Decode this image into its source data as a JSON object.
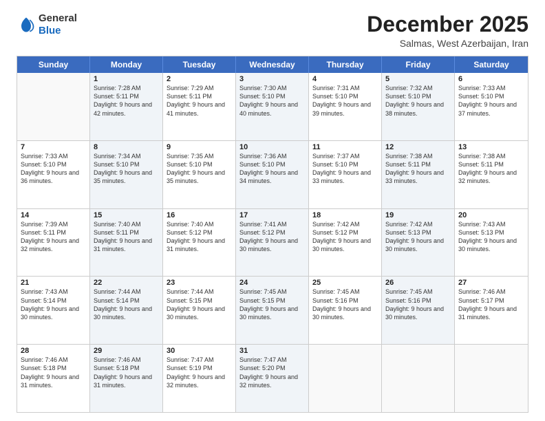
{
  "logo": {
    "general": "General",
    "blue": "Blue"
  },
  "header": {
    "month": "December 2025",
    "location": "Salmas, West Azerbaijan, Iran"
  },
  "weekdays": [
    "Sunday",
    "Monday",
    "Tuesday",
    "Wednesday",
    "Thursday",
    "Friday",
    "Saturday"
  ],
  "weeks": [
    [
      {
        "day": "",
        "sunrise": "",
        "sunset": "",
        "daylight": "",
        "shaded": false,
        "empty": true
      },
      {
        "day": "1",
        "sunrise": "Sunrise: 7:28 AM",
        "sunset": "Sunset: 5:11 PM",
        "daylight": "Daylight: 9 hours and 42 minutes.",
        "shaded": true
      },
      {
        "day": "2",
        "sunrise": "Sunrise: 7:29 AM",
        "sunset": "Sunset: 5:11 PM",
        "daylight": "Daylight: 9 hours and 41 minutes.",
        "shaded": false
      },
      {
        "day": "3",
        "sunrise": "Sunrise: 7:30 AM",
        "sunset": "Sunset: 5:10 PM",
        "daylight": "Daylight: 9 hours and 40 minutes.",
        "shaded": true
      },
      {
        "day": "4",
        "sunrise": "Sunrise: 7:31 AM",
        "sunset": "Sunset: 5:10 PM",
        "daylight": "Daylight: 9 hours and 39 minutes.",
        "shaded": false
      },
      {
        "day": "5",
        "sunrise": "Sunrise: 7:32 AM",
        "sunset": "Sunset: 5:10 PM",
        "daylight": "Daylight: 9 hours and 38 minutes.",
        "shaded": true
      },
      {
        "day": "6",
        "sunrise": "Sunrise: 7:33 AM",
        "sunset": "Sunset: 5:10 PM",
        "daylight": "Daylight: 9 hours and 37 minutes.",
        "shaded": false
      }
    ],
    [
      {
        "day": "7",
        "sunrise": "Sunrise: 7:33 AM",
        "sunset": "Sunset: 5:10 PM",
        "daylight": "Daylight: 9 hours and 36 minutes.",
        "shaded": false
      },
      {
        "day": "8",
        "sunrise": "Sunrise: 7:34 AM",
        "sunset": "Sunset: 5:10 PM",
        "daylight": "Daylight: 9 hours and 35 minutes.",
        "shaded": true
      },
      {
        "day": "9",
        "sunrise": "Sunrise: 7:35 AM",
        "sunset": "Sunset: 5:10 PM",
        "daylight": "Daylight: 9 hours and 35 minutes.",
        "shaded": false
      },
      {
        "day": "10",
        "sunrise": "Sunrise: 7:36 AM",
        "sunset": "Sunset: 5:10 PM",
        "daylight": "Daylight: 9 hours and 34 minutes.",
        "shaded": true
      },
      {
        "day": "11",
        "sunrise": "Sunrise: 7:37 AM",
        "sunset": "Sunset: 5:10 PM",
        "daylight": "Daylight: 9 hours and 33 minutes.",
        "shaded": false
      },
      {
        "day": "12",
        "sunrise": "Sunrise: 7:38 AM",
        "sunset": "Sunset: 5:11 PM",
        "daylight": "Daylight: 9 hours and 33 minutes.",
        "shaded": true
      },
      {
        "day": "13",
        "sunrise": "Sunrise: 7:38 AM",
        "sunset": "Sunset: 5:11 PM",
        "daylight": "Daylight: 9 hours and 32 minutes.",
        "shaded": false
      }
    ],
    [
      {
        "day": "14",
        "sunrise": "Sunrise: 7:39 AM",
        "sunset": "Sunset: 5:11 PM",
        "daylight": "Daylight: 9 hours and 32 minutes.",
        "shaded": false
      },
      {
        "day": "15",
        "sunrise": "Sunrise: 7:40 AM",
        "sunset": "Sunset: 5:11 PM",
        "daylight": "Daylight: 9 hours and 31 minutes.",
        "shaded": true
      },
      {
        "day": "16",
        "sunrise": "Sunrise: 7:40 AM",
        "sunset": "Sunset: 5:12 PM",
        "daylight": "Daylight: 9 hours and 31 minutes.",
        "shaded": false
      },
      {
        "day": "17",
        "sunrise": "Sunrise: 7:41 AM",
        "sunset": "Sunset: 5:12 PM",
        "daylight": "Daylight: 9 hours and 30 minutes.",
        "shaded": true
      },
      {
        "day": "18",
        "sunrise": "Sunrise: 7:42 AM",
        "sunset": "Sunset: 5:12 PM",
        "daylight": "Daylight: 9 hours and 30 minutes.",
        "shaded": false
      },
      {
        "day": "19",
        "sunrise": "Sunrise: 7:42 AM",
        "sunset": "Sunset: 5:13 PM",
        "daylight": "Daylight: 9 hours and 30 minutes.",
        "shaded": true
      },
      {
        "day": "20",
        "sunrise": "Sunrise: 7:43 AM",
        "sunset": "Sunset: 5:13 PM",
        "daylight": "Daylight: 9 hours and 30 minutes.",
        "shaded": false
      }
    ],
    [
      {
        "day": "21",
        "sunrise": "Sunrise: 7:43 AM",
        "sunset": "Sunset: 5:14 PM",
        "daylight": "Daylight: 9 hours and 30 minutes.",
        "shaded": false
      },
      {
        "day": "22",
        "sunrise": "Sunrise: 7:44 AM",
        "sunset": "Sunset: 5:14 PM",
        "daylight": "Daylight: 9 hours and 30 minutes.",
        "shaded": true
      },
      {
        "day": "23",
        "sunrise": "Sunrise: 7:44 AM",
        "sunset": "Sunset: 5:15 PM",
        "daylight": "Daylight: 9 hours and 30 minutes.",
        "shaded": false
      },
      {
        "day": "24",
        "sunrise": "Sunrise: 7:45 AM",
        "sunset": "Sunset: 5:15 PM",
        "daylight": "Daylight: 9 hours and 30 minutes.",
        "shaded": true
      },
      {
        "day": "25",
        "sunrise": "Sunrise: 7:45 AM",
        "sunset": "Sunset: 5:16 PM",
        "daylight": "Daylight: 9 hours and 30 minutes.",
        "shaded": false
      },
      {
        "day": "26",
        "sunrise": "Sunrise: 7:45 AM",
        "sunset": "Sunset: 5:16 PM",
        "daylight": "Daylight: 9 hours and 30 minutes.",
        "shaded": true
      },
      {
        "day": "27",
        "sunrise": "Sunrise: 7:46 AM",
        "sunset": "Sunset: 5:17 PM",
        "daylight": "Daylight: 9 hours and 31 minutes.",
        "shaded": false
      }
    ],
    [
      {
        "day": "28",
        "sunrise": "Sunrise: 7:46 AM",
        "sunset": "Sunset: 5:18 PM",
        "daylight": "Daylight: 9 hours and 31 minutes.",
        "shaded": false
      },
      {
        "day": "29",
        "sunrise": "Sunrise: 7:46 AM",
        "sunset": "Sunset: 5:18 PM",
        "daylight": "Daylight: 9 hours and 31 minutes.",
        "shaded": true
      },
      {
        "day": "30",
        "sunrise": "Sunrise: 7:47 AM",
        "sunset": "Sunset: 5:19 PM",
        "daylight": "Daylight: 9 hours and 32 minutes.",
        "shaded": false
      },
      {
        "day": "31",
        "sunrise": "Sunrise: 7:47 AM",
        "sunset": "Sunset: 5:20 PM",
        "daylight": "Daylight: 9 hours and 32 minutes.",
        "shaded": true
      },
      {
        "day": "",
        "sunrise": "",
        "sunset": "",
        "daylight": "",
        "shaded": false,
        "empty": true
      },
      {
        "day": "",
        "sunrise": "",
        "sunset": "",
        "daylight": "",
        "shaded": false,
        "empty": true
      },
      {
        "day": "",
        "sunrise": "",
        "sunset": "",
        "daylight": "",
        "shaded": false,
        "empty": true
      }
    ]
  ]
}
